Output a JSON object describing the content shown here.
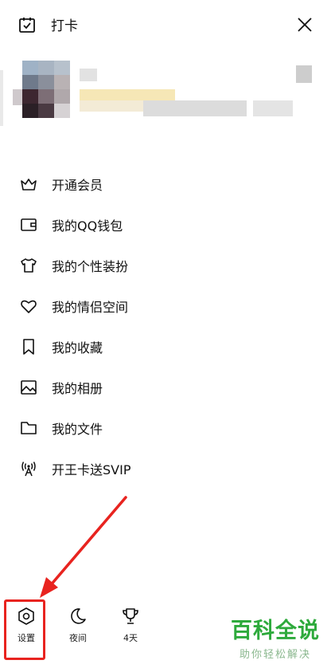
{
  "header": {
    "checkin_label": "打卡",
    "checkin_icon": "calendar-check-icon",
    "close_icon": "close-icon"
  },
  "menu": [
    {
      "label": "开通会员",
      "icon": "crown-icon"
    },
    {
      "label": "我的QQ钱包",
      "icon": "wallet-icon"
    },
    {
      "label": "我的个性装扮",
      "icon": "tshirt-icon"
    },
    {
      "label": "我的情侣空间",
      "icon": "heart-icon"
    },
    {
      "label": "我的收藏",
      "icon": "bookmark-icon"
    },
    {
      "label": "我的相册",
      "icon": "image-icon"
    },
    {
      "label": "我的文件",
      "icon": "folder-icon"
    },
    {
      "label": "开王卡送SVIP",
      "icon": "signal-tower-icon"
    }
  ],
  "bottom": {
    "settings_label": "设置",
    "night_label": "夜间",
    "days_label": "4天"
  },
  "watermark": {
    "title": "百科全说",
    "subtitle": "助你轻松解决"
  },
  "colors": {
    "highlight": "#e8231f",
    "watermark_green": "#2eaa3c"
  }
}
